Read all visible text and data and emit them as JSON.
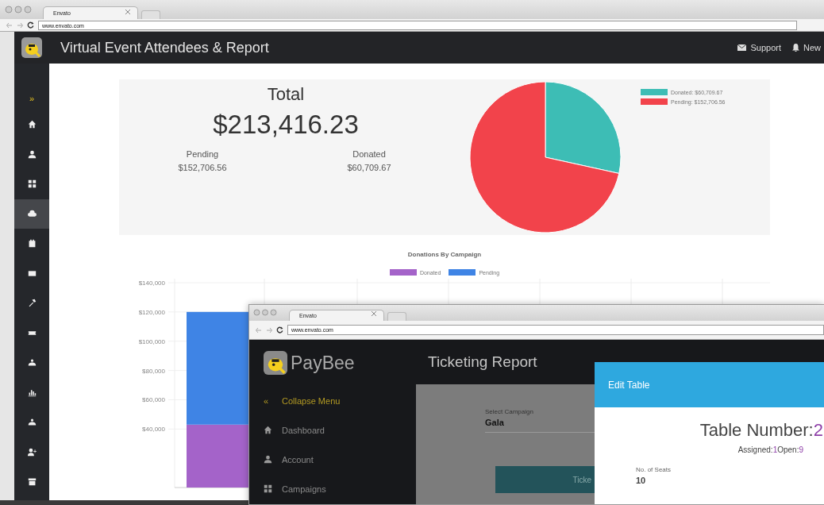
{
  "browser": {
    "tab_title": "Envato",
    "url": "www.envato.com"
  },
  "header": {
    "title": "Virtual Event Attendees & Report",
    "links": [
      "Support",
      "New"
    ]
  },
  "sidebar": {
    "toggle": "»",
    "items": [
      {
        "selected": false
      },
      {
        "selected": false
      },
      {
        "selected": false
      },
      {
        "selected": true
      },
      {
        "selected": false
      },
      {
        "selected": false
      },
      {
        "selected": false
      },
      {
        "selected": false
      },
      {
        "selected": false
      },
      {
        "selected": false
      },
      {
        "selected": false
      },
      {
        "selected": false
      },
      {
        "selected": false
      }
    ]
  },
  "summary": {
    "total_label": "Total",
    "total": "$213,416.23",
    "stats": [
      {
        "label": "Pending",
        "value": "$152,706.56"
      },
      {
        "label": "Donated",
        "value": "$60,709.67"
      }
    ],
    "legend": [
      {
        "label": "Donated: $60,709.67",
        "color": "#3dbdb5"
      },
      {
        "label": "Pending: $152,706.56",
        "color": "#f2434b"
      }
    ],
    "chart_data": {
      "type": "pie",
      "values": [
        28.45,
        71.55
      ]
    }
  },
  "campaign_chart": {
    "chart_data": {
      "type": "bar",
      "title": "Donations By Campaign",
      "stacked": true,
      "grid": true,
      "ylim": [
        0,
        140000
      ],
      "yticks": [
        {
          "value": 40000,
          "label": "$40,000"
        },
        {
          "value": 60000,
          "label": "$60,000"
        },
        {
          "value": 80000,
          "label": "$80,000"
        },
        {
          "value": 100000,
          "label": "$100,000"
        },
        {
          "value": 120000,
          "label": "$120,000"
        },
        {
          "value": 140000,
          "label": "$140,000"
        }
      ],
      "series": [
        {
          "name": "Donated",
          "color": "#a463c9",
          "values": [
            43000
          ]
        },
        {
          "name": "Pending",
          "color": "#3f84e5",
          "values": [
            77000
          ]
        }
      ]
    }
  },
  "overlay_window": {
    "tab_title": "Envato",
    "url": "www.envato.com",
    "brand": "PayBee",
    "menu": [
      {
        "kind": "collapse",
        "glyph": "«",
        "label": "Collapse Menu"
      },
      {
        "kind": "link",
        "label": "Dashboard"
      },
      {
        "kind": "link",
        "label": "Account"
      },
      {
        "kind": "link",
        "label": "Campaigns"
      }
    ],
    "page_title": "Ticketing Report",
    "campaign_field": {
      "label": "Select Campaign",
      "value": "Gala"
    },
    "button": "Ticke",
    "modal": {
      "title": "Edit Table",
      "table_label": "Table Number:",
      "table_number": "2",
      "assigned_label": "Assigned:",
      "assigned": "1",
      "open_label": "Open:",
      "open": "9",
      "seats_label": "No. of Seats",
      "seats": "10"
    }
  }
}
